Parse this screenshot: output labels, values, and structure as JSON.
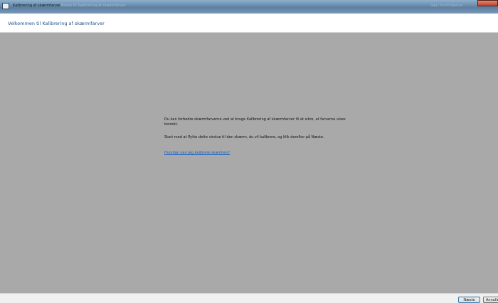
{
  "window": {
    "title": "Kalibrering af skærmfarver",
    "blurred_left": "Ændre til Kalibrering af skærmfarver",
    "blurred_right": "Søg i Kontrolpanel"
  },
  "header": {
    "title": "Velkommen til Kalibrering af skærmfarver"
  },
  "content": {
    "paragraph1": "Du kan forbedre skærmfarverne ved at bruge Kalibrering af skærmfarver til at sikre, at farverne vises korrekt.",
    "paragraph2": "Start med at flytte dette vindue til den skærm, du vil kalibrere, og klik derefter på Næste.",
    "help_link": "Hvordan kan jeg kalibrere skærmen?"
  },
  "footer": {
    "next_label": "Næste",
    "cancel_label": "Annuller"
  }
}
